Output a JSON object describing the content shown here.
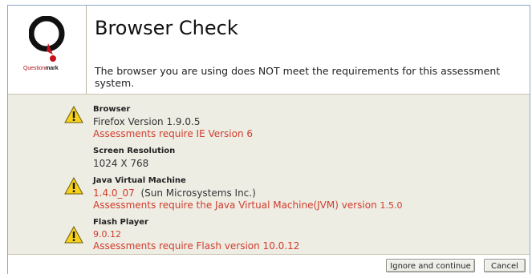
{
  "header": {
    "title": "Browser Check",
    "message": "The browser you are using does NOT meet the requirements for this assessment system.",
    "logo": {
      "brand_part": "Question",
      "brand_bold": "mark",
      "icon": "questionmark-logo-icon"
    }
  },
  "checks": [
    {
      "label": "Browser",
      "value": "Firefox Version 1.9.0.5",
      "error": "Assessments require IE Version 6",
      "icon": "warning-icon"
    },
    {
      "label": "Screen Resolution",
      "value": "1024 X 768"
    },
    {
      "label": "Java Virtual Machine",
      "value_version": "1.4.0_07",
      "value_vendor": "(Sun Microsystems Inc.)",
      "error_text": "Assessments require the Java Virtual Machine(JVM) version",
      "error_version": "1.5.0",
      "icon": "warning-icon"
    },
    {
      "label": "Flash Player",
      "value": "9.0.12",
      "error": "Assessments require Flash version 10.0.12",
      "icon": "warning-icon"
    }
  ],
  "footer": {
    "ignore_label": "Ignore and continue",
    "cancel_label": "Cancel"
  },
  "colors": {
    "error": "#d03c2c",
    "panel": "#eeede4",
    "warning": "#f7d21a"
  }
}
